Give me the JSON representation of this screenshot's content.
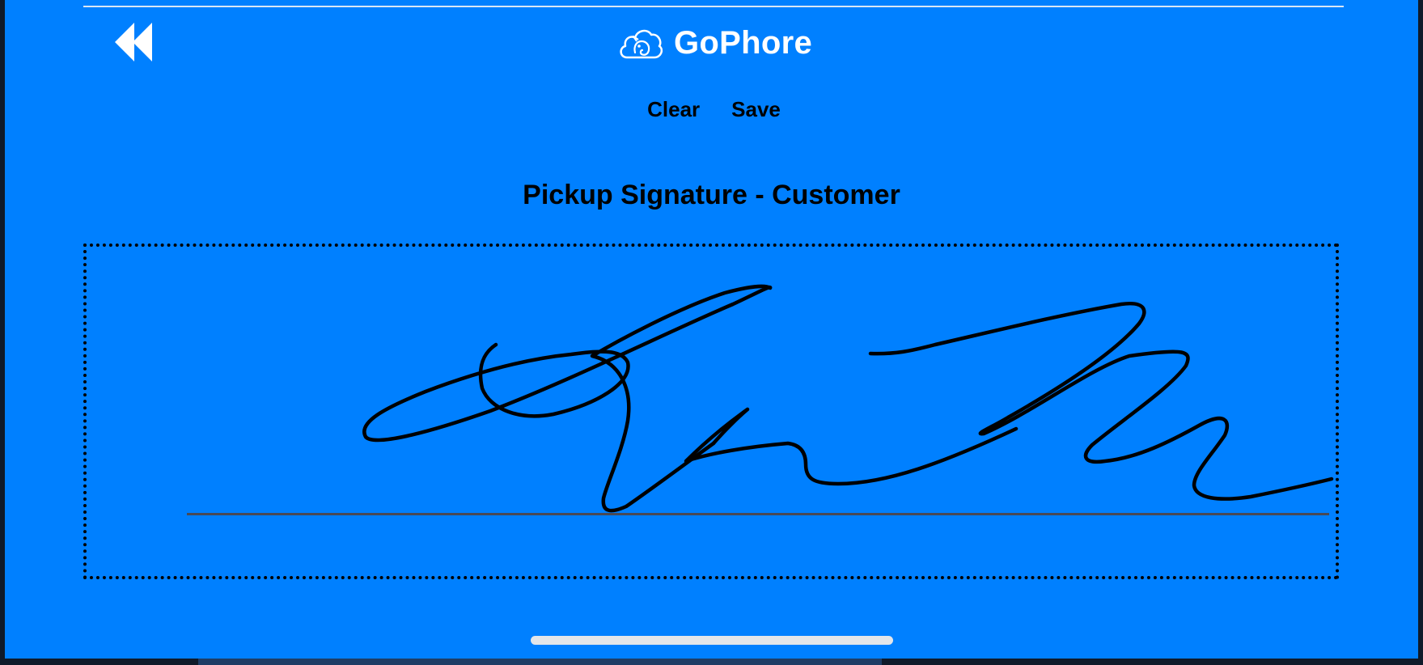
{
  "header": {
    "brand_name": "GoPhore",
    "back_icon": "double-chevron-left-icon",
    "logo_icon": "cloud-dog-logo-icon"
  },
  "actions": {
    "clear_label": "Clear",
    "save_label": "Save"
  },
  "signature": {
    "heading": "Pickup Signature - Customer"
  },
  "colors": {
    "background": "#0080ff",
    "text": "#000000",
    "brand_text": "#ffffff"
  }
}
